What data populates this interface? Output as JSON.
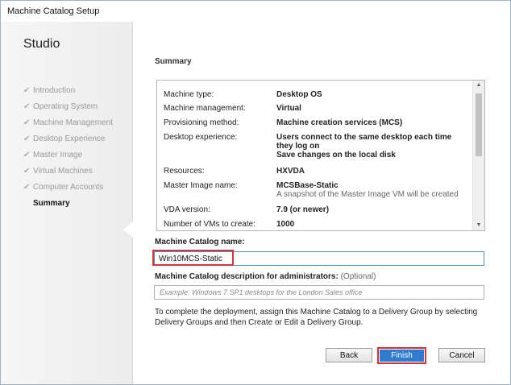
{
  "window": {
    "title": "Machine Catalog Setup"
  },
  "sidebar": {
    "brand": "Studio",
    "steps": [
      {
        "label": "Introduction",
        "done": true
      },
      {
        "label": "Operating System",
        "done": true
      },
      {
        "label": "Machine Management",
        "done": true
      },
      {
        "label": "Desktop Experience",
        "done": true
      },
      {
        "label": "Master Image",
        "done": true
      },
      {
        "label": "Virtual Machines",
        "done": true
      },
      {
        "label": "Computer Accounts",
        "done": true
      },
      {
        "label": "Summary",
        "done": false,
        "current": true
      }
    ]
  },
  "main": {
    "heading": "Summary",
    "summary": [
      {
        "key": "Machine type:",
        "value": "Desktop OS"
      },
      {
        "key": "Machine management:",
        "value": "Virtual"
      },
      {
        "key": "Provisioning method:",
        "value": "Machine creation services (MCS)"
      },
      {
        "key": "Desktop experience:",
        "value": "Users connect to the same desktop each time they log on",
        "value2": "Save changes on the local disk"
      },
      {
        "key": "Resources:",
        "value": "HXVDA"
      },
      {
        "key": "Master Image name:",
        "value": "MCSBase-Static",
        "sub": "A snapshot of the Master Image VM will be created"
      },
      {
        "key": "VDA version:",
        "value": "7.9 (or newer)"
      },
      {
        "key": "Number of VMs to create:",
        "value": "1000"
      }
    ],
    "catalog_name_label": "Machine Catalog name:",
    "catalog_name_value": "Win10MCS-Static",
    "description_label": "Machine Catalog description for administrators:",
    "description_optional": "(Optional)",
    "description_placeholder": "Example: Windows 7 SP1 desktops for the London Sales office",
    "info_text": "To complete the deployment, assign this Machine Catalog to a Delivery Group by selecting Delivery Groups and then Create or Edit a Delivery Group."
  },
  "buttons": {
    "back": "Back",
    "finish": "Finish",
    "cancel": "Cancel"
  },
  "colors": {
    "accent": "#2e7bd0",
    "highlight": "#d0353b",
    "focus_border": "#4d8fd0"
  }
}
